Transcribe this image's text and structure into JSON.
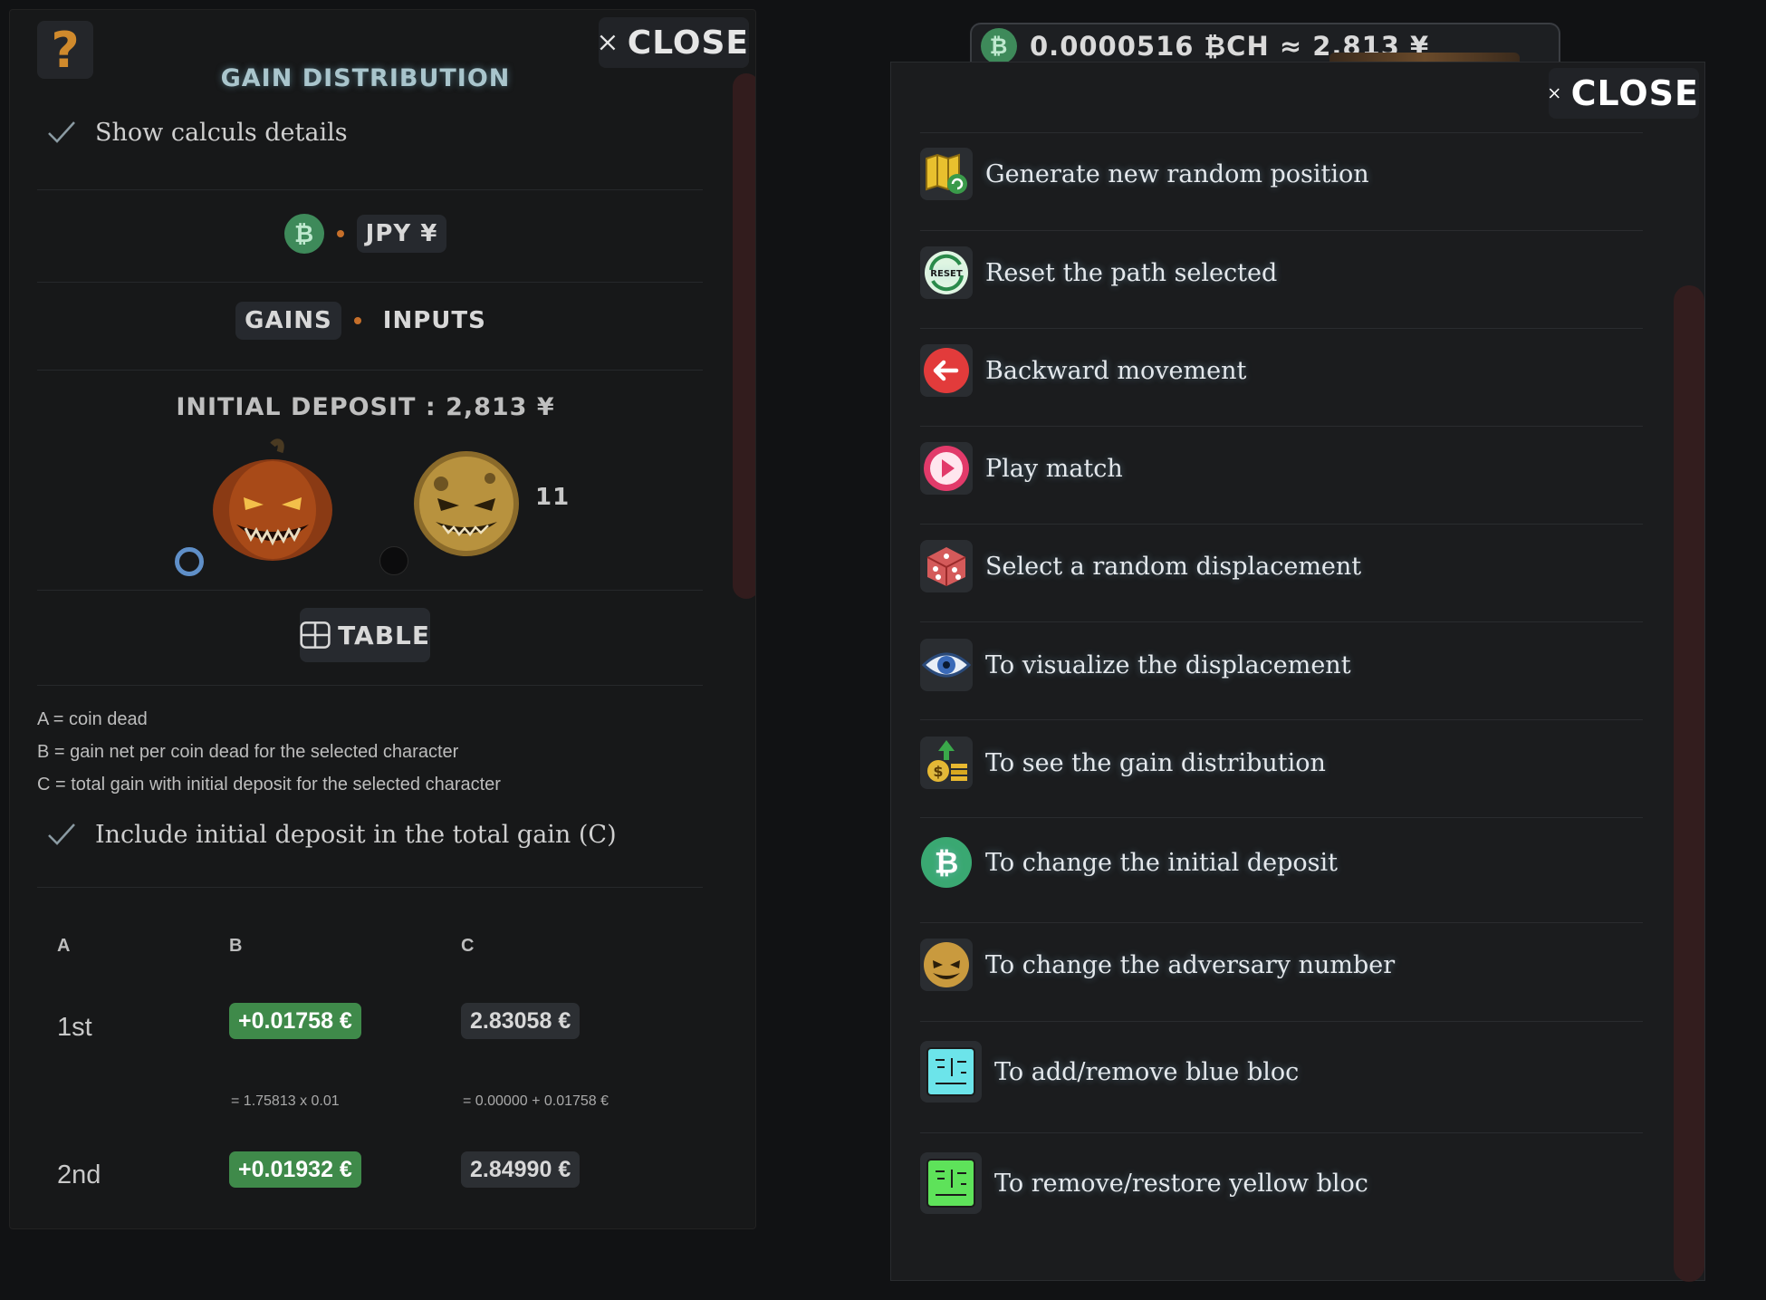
{
  "left": {
    "help_label": "?",
    "close_label": "CLOSE",
    "title": "GAIN DISTRIBUTION",
    "show_details_label": "Show calculs details",
    "currency_code": "JPY ¥",
    "bch_symbol": "₿",
    "tabs": [
      "GAINS",
      "INPUTS"
    ],
    "deposit_title": "INITIAL DEPOSIT : 2,813 ¥",
    "adversary_count": "11",
    "table_label": "TABLE",
    "legend": [
      "A = coin dead",
      "B = gain net per coin dead for the selected character",
      "C = total gain with initial deposit for the selected character"
    ],
    "include_deposit_label": "Include initial deposit in the total gain (C)",
    "table": {
      "headers": [
        "A",
        "B",
        "C"
      ],
      "rows": [
        {
          "rank": "1st",
          "gain": "+0.01758 €",
          "total": "2.83058 €",
          "gain_formula": "= 1.75813 x 0.01",
          "total_formula": "= 0.00000 + 0.01758 €"
        },
        {
          "rank": "2nd",
          "gain": "+0.01932 €",
          "total": "2.84990 €"
        }
      ]
    }
  },
  "top_bar": {
    "balance": "0.0000516 ₿CH ≈ 2,813 ¥",
    "bch_symbol": "₿"
  },
  "right": {
    "close_label": "CLOSE",
    "items": [
      {
        "icon": "map-icon",
        "label": "Generate new random position"
      },
      {
        "icon": "reset-icon",
        "label": "Reset the path selected"
      },
      {
        "icon": "back-arrow-icon",
        "label": "Backward movement"
      },
      {
        "icon": "play-icon",
        "label": "Play match"
      },
      {
        "icon": "dice-icon",
        "label": "Select a random displacement"
      },
      {
        "icon": "eye-icon",
        "label": "To visualize the displacement"
      },
      {
        "icon": "money-icon",
        "label": "To see the gain distribution"
      },
      {
        "icon": "bitcoin-cash-icon",
        "label": "To change the initial deposit"
      },
      {
        "icon": "adversary-icon",
        "label": "To change the adversary number"
      },
      {
        "icon": "blue-bloc-icon",
        "label": "To add/remove blue bloc"
      },
      {
        "icon": "yellow-bloc-icon",
        "label": "To remove/restore yellow bloc"
      }
    ]
  },
  "colors": {
    "accent_green": "#3f8a4a",
    "orange_dot": "#c66f2a",
    "background": "#111214"
  }
}
